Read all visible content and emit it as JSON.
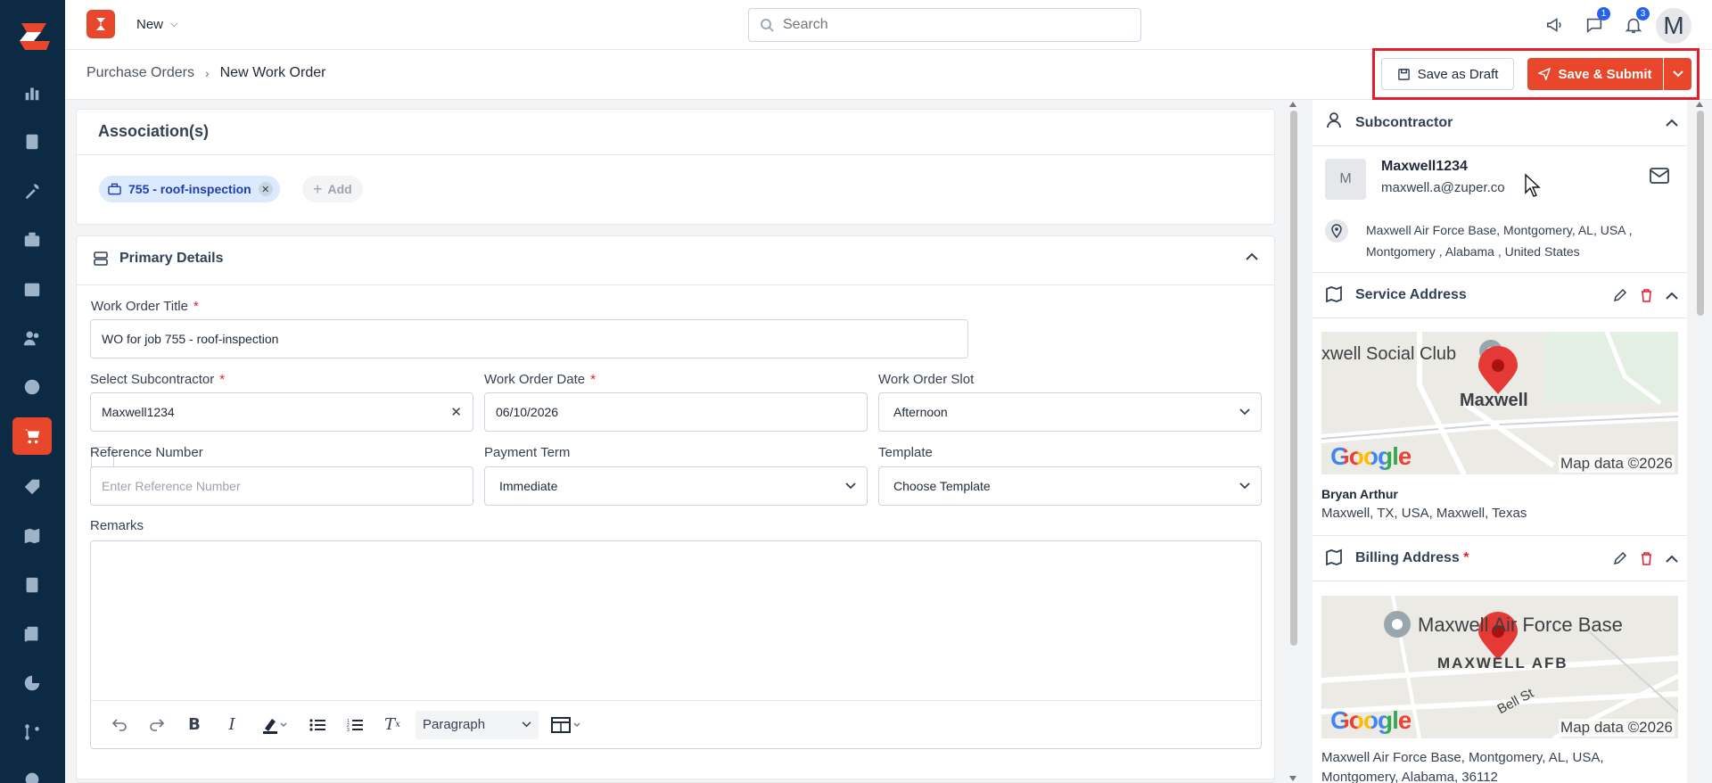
{
  "topbar": {
    "new_label": "New",
    "search_placeholder": "Search",
    "chat_badge": "1",
    "bell_badge": "3",
    "avatar_initial": "M"
  },
  "breadcrumb": {
    "parent": "Purchase Orders",
    "current": "New Work Order"
  },
  "actions": {
    "draft_label": "Save as Draft",
    "submit_label": "Save & Submit"
  },
  "associations": {
    "title": "Association(s)",
    "chip_label": "755 - roof-inspection",
    "add_label": "Add"
  },
  "primary": {
    "title": "Primary Details",
    "fields": {
      "title_label": "Work Order Title",
      "title_value": "WO for job 755 - roof-inspection",
      "subcontractor_label": "Select Subcontractor",
      "subcontractor_value": "Maxwell1234",
      "date_label": "Work Order Date",
      "date_value": "06/10/2026",
      "slot_label": "Work Order Slot",
      "slot_value": "Afternoon",
      "reference_label": "Reference Number",
      "reference_placeholder": "Enter Reference Number",
      "payment_label": "Payment Term",
      "payment_value": "Immediate",
      "template_label": "Template",
      "template_value": "Choose Template",
      "remarks_label": "Remarks",
      "required_mark": "*"
    },
    "editor": {
      "paragraph_label": "Paragraph"
    }
  },
  "subcontractor": {
    "title": "Subcontractor",
    "avatar_initial": "M",
    "name": "Maxwell1234",
    "email": "maxwell.a@zuper.co",
    "address_line1": "Maxwell Air Force Base, Montgomery, AL, USA ,",
    "address_line2": "Montgomery , Alabama , United States"
  },
  "service_address": {
    "title": "Service Address",
    "map_labels": [
      "xwell Social Club",
      "Maxwell"
    ],
    "map_brand": "Google",
    "map_credit": "Map data ©2026",
    "contact_name": "Bryan Arthur",
    "address": "Maxwell, TX, USA, Maxwell, Texas"
  },
  "billing_address": {
    "title": "Billing Address",
    "required_mark": "*",
    "map_labels": [
      "Maxwell Air Force Base",
      "MAXWELL AFB",
      "Bell St"
    ],
    "map_brand": "Google",
    "map_credit": "Map data ©2026",
    "address": "Maxwell Air Force Base, Montgomery, AL, USA,",
    "address_cut": "Montgomery, Alabama, 36112"
  },
  "colors": {
    "rail": "#0d2a45",
    "accent": "#e8472b",
    "highlight_box": "#e11d2e",
    "chip_bg": "#dbeafe"
  }
}
